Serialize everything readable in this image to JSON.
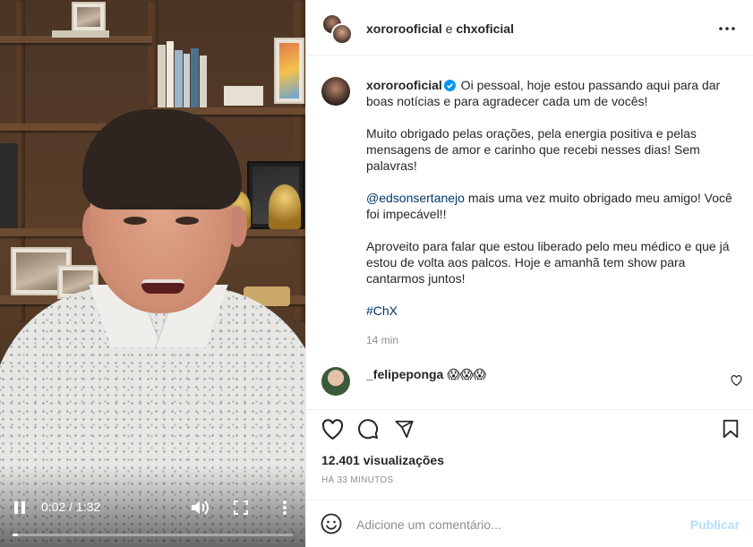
{
  "video": {
    "time": "0:02 / 1:32",
    "progress": 0.02
  },
  "header": {
    "user1": "xororooficial",
    "connector": " e ",
    "user2": "chxoficial"
  },
  "caption": {
    "username": "xororooficial",
    "line1": " Oi pessoal, hoje estou passando aqui para dar boas notícias e para agradecer cada um de vocês!",
    "p2": "Muito obrigado pelas orações, pela energia positiva e pelas mensagens de amor e carinho que recebi nesses dias! Sem palavras!",
    "mention": "@edsonsertanejo",
    "p3_rest": " mais uma vez muito obrigado meu amigo! Você foi impecável!!",
    "p4": "Aproveito para falar que estou liberado pelo meu médico e que já estou de volta aos palcos. Hoje e amanhã tem show para cantarmos juntos!",
    "hashtag": "#ChX",
    "time": "14 min"
  },
  "comment": {
    "username": "_felipeponga",
    "text": "😱😱😱"
  },
  "stats": {
    "views": "12.401 visualizações",
    "posted": "HÁ 33 MINUTOS"
  },
  "compose": {
    "placeholder": "Adicione um comentário...",
    "publish": "Publicar"
  },
  "colors": {
    "verified": "#0095f6",
    "link": "#00376b",
    "muted": "#8e8e8e",
    "publish_disabled": "#b2dffc"
  },
  "icons": [
    "play-pause-icon",
    "volume-icon",
    "fullscreen-icon",
    "more-icon",
    "verified-badge-icon",
    "heart-icon",
    "comment-icon",
    "share-icon",
    "save-icon",
    "emoji-icon"
  ]
}
